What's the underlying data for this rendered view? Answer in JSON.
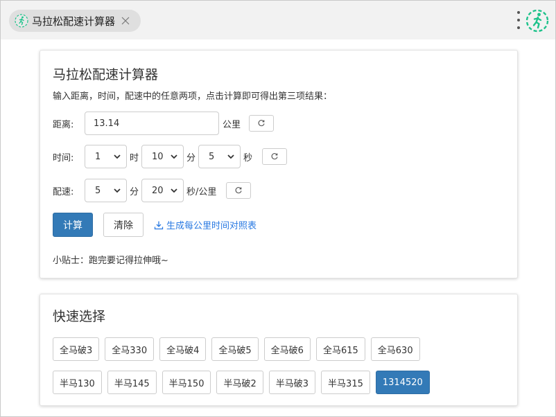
{
  "tab": {
    "title": "马拉松配速计算器",
    "icon": "runner-icon"
  },
  "colors": {
    "accent": "#337ab7",
    "link": "#2a7ae2",
    "logo": "#1ec28b"
  },
  "calculator": {
    "title": "马拉松配速计算器",
    "intro": "输入距离，时间，配速中的任意两项，点击计算即可得出第三项结果：",
    "distance": {
      "label": "距离:",
      "value": "13.14",
      "unit": "公里"
    },
    "time": {
      "label": "时间:",
      "hours": "1",
      "hours_unit": "时",
      "minutes": "10",
      "minutes_unit": "分",
      "seconds": "5",
      "seconds_unit": "秒"
    },
    "pace": {
      "label": "配速:",
      "minutes": "5",
      "minutes_unit": "分",
      "seconds": "20",
      "seconds_unit": "秒/公里"
    },
    "calculate_label": "计算",
    "clear_label": "清除",
    "download_link": "生成每公里时间对照表",
    "tip": "小贴士：跑完要记得拉伸哦~"
  },
  "quick": {
    "title": "快速选择",
    "row1": [
      "全马破3",
      "全马330",
      "全马破4",
      "全马破5",
      "全马破6",
      "全马615",
      "全马630"
    ],
    "row2": [
      "半马130",
      "半马145",
      "半马150",
      "半马破2",
      "半马破3",
      "半马315",
      "1314520"
    ],
    "selected": "1314520"
  }
}
